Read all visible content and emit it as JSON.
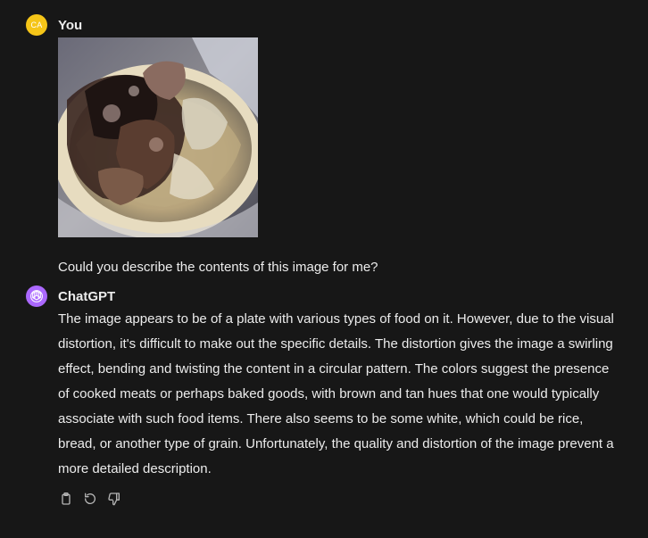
{
  "user_message": {
    "avatar_initials": "CA",
    "author": "You",
    "text": "Could you describe the contents of this image for me?"
  },
  "assistant_message": {
    "author": "ChatGPT",
    "text": "The image appears to be of a plate with various types of food on it. However, due to the visual distortion, it's difficult to make out the specific details. The distortion gives the image a swirling effect, bending and twisting the content in a circular pattern. The colors suggest the presence of cooked meats or perhaps baked goods, with brown and tan hues that one would typically associate with such food items. There also seems to be some white, which could be rice, bread, or another type of grain. Unfortunately, the quality and distortion of the image prevent a more detailed description."
  },
  "actions": [
    {
      "icon": "clipboard-icon"
    },
    {
      "icon": "regenerate-icon"
    },
    {
      "icon": "thumbs-down-icon"
    }
  ],
  "colors": {
    "background": "#171717",
    "text": "#ececec",
    "user_avatar": "#f5c518",
    "assistant_avatar": "#ab68ff",
    "icon": "#b4b4b4"
  }
}
